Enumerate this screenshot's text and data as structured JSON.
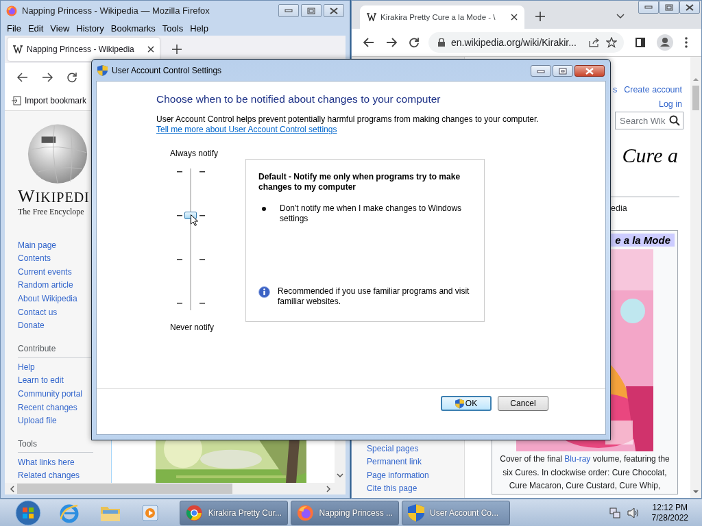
{
  "firefox": {
    "title": "Napping Princess - Wikipedia — Mozilla Firefox",
    "menu": [
      "File",
      "Edit",
      "View",
      "History",
      "Bookmarks",
      "Tools",
      "Help"
    ],
    "tab": {
      "label": "Napping Princess - Wikipedia",
      "selected": true
    },
    "bookmark": "Import bookmark",
    "logo": {
      "wordmark": "WIKIPEDI",
      "tagline": "The Free Encyclope"
    },
    "nav_links": [
      "Main page",
      "Contents",
      "Current events",
      "Random article",
      "About Wikipedia",
      "Contact us",
      "Donate"
    ],
    "sections": [
      {
        "heading": "Contribute",
        "links": [
          "Help",
          "Learn to edit",
          "Community portal",
          "Recent changes",
          "Upload file"
        ]
      },
      {
        "heading": "Tools",
        "links": [
          "What links here",
          "Related changes"
        ]
      }
    ]
  },
  "chrome": {
    "tab": {
      "label": "Kirakira Pretty Cure a la Mode - \\",
      "selected": true
    },
    "url": "en.wikipedia.org/wiki/Kirakir...",
    "personal_links": [
      "s",
      "Create account"
    ],
    "login": "Log in",
    "search": {
      "placeholder": "Search Wik"
    },
    "heading": "Cure a",
    "tagline": "edia",
    "infobox_title": "e a la Mode",
    "caption": {
      "before": "Cover of the final ",
      "link": "Blu-ray",
      "after": " volume, featuring the six Cures. In clockwise order: Cure Chocolat, Cure Macaron, Cure Custard, Cure Whip,"
    },
    "sidebar_links": [
      "Special pages",
      "Permanent link",
      "Page information",
      "Cite this page"
    ]
  },
  "dialog": {
    "title": "User Account Control Settings",
    "heading": "Choose when to be notified about changes to your computer",
    "description": "User Account Control helps prevent potentially harmful programs from making changes to your computer.",
    "link": "Tell me more about User Account Control settings",
    "slider": {
      "top_label": "Always notify",
      "bottom_label": "Never notify",
      "level": 0.667
    },
    "panel": {
      "title": "Default - Notify me only when programs try to make changes to my computer",
      "bullets": [
        "Don't notify me when I make changes to Windows settings"
      ],
      "note": "Recommended if you use familiar programs and visit familiar websites."
    },
    "buttons": [
      {
        "label": "OK",
        "kind": "primary"
      },
      {
        "label": "Cancel",
        "kind": "normal"
      }
    ]
  },
  "taskbar": {
    "tasks": [
      {
        "label": "Kirakira Pretty Cur...",
        "kind": "chrome",
        "selected": false
      },
      {
        "label": "Napping Princess ...",
        "kind": "firefox",
        "selected": false
      },
      {
        "label": "User Account Co...",
        "kind": "shield",
        "selected": true
      }
    ],
    "time": "12:12 PM",
    "date": "7/28/2022"
  }
}
